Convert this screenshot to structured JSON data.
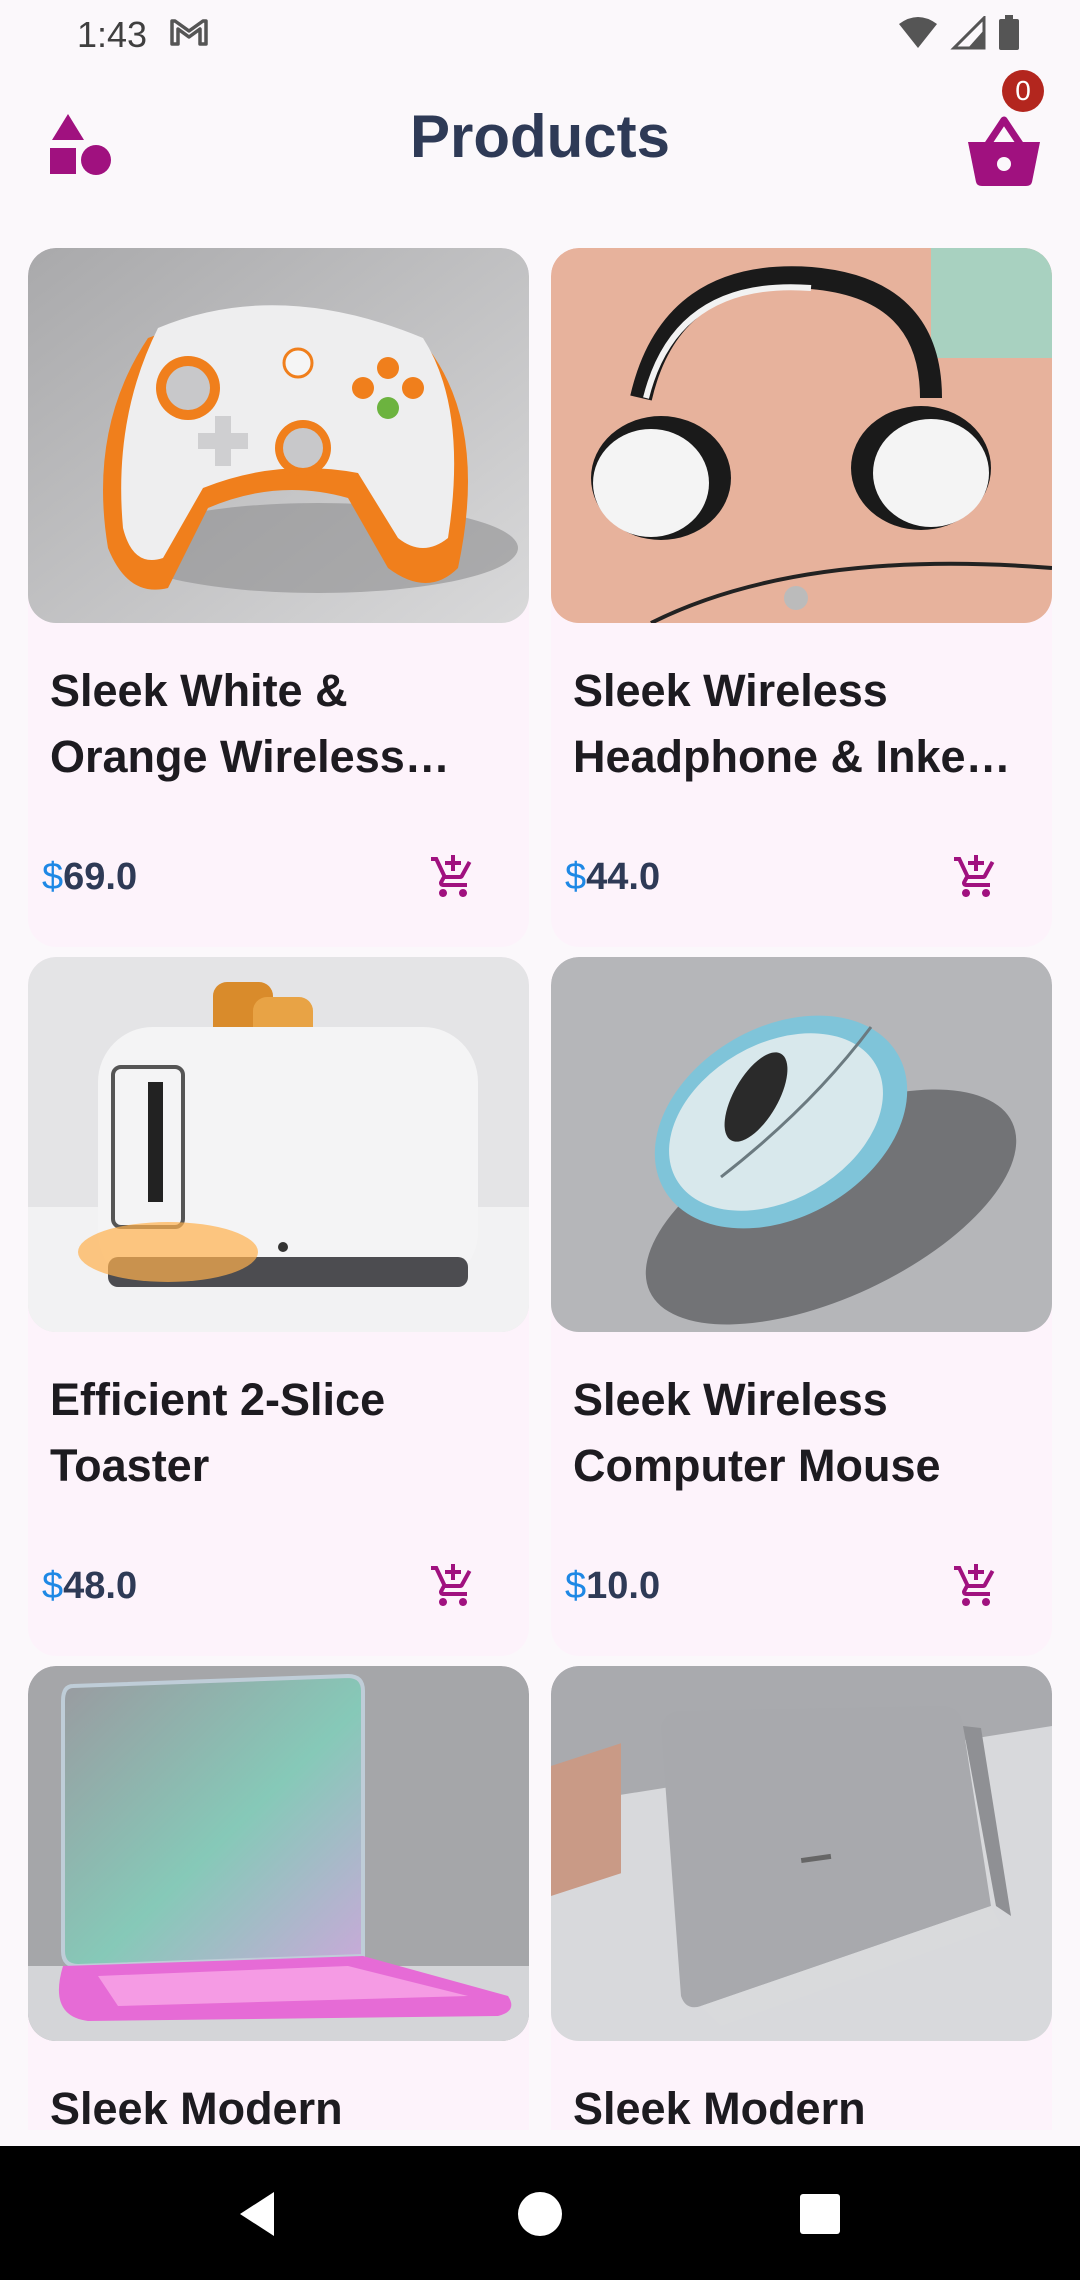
{
  "status_bar": {
    "time": "1:43",
    "icons": [
      "gmail-icon",
      "wifi-icon",
      "signal-icon",
      "battery-icon"
    ]
  },
  "app_bar": {
    "title": "Products",
    "categories_icon": "shapes-icon",
    "cart_icon": "basket-icon",
    "cart_count": "0"
  },
  "colors": {
    "accent": "#a0117f",
    "title": "#2e3a56",
    "currency": "#1e88e5",
    "badge": "#b3261e",
    "card_bg": "#fdf3fb"
  },
  "products": [
    {
      "title": "Sleek White & Orange Wireless Gaming Controller",
      "currency": "$",
      "price": "69.0",
      "image": "game-controller"
    },
    {
      "title": "Sleek Wireless Headphone & Inked Earbud Set",
      "currency": "$",
      "price": "44.0",
      "image": "headphones"
    },
    {
      "title": "Efficient 2-Slice Toaster",
      "currency": "$",
      "price": "48.0",
      "image": "toaster"
    },
    {
      "title": "Sleek Wireless Computer Mouse",
      "currency": "$",
      "price": "10.0",
      "image": "mouse"
    },
    {
      "title": "Sleek Modern",
      "currency": "$",
      "price": "",
      "image": "laptop-glow"
    },
    {
      "title": "Sleek Modern",
      "currency": "$",
      "price": "",
      "image": "laptop-silver"
    }
  ],
  "nav_bar": {
    "icons": [
      "back-icon",
      "home-icon",
      "recents-icon"
    ]
  }
}
